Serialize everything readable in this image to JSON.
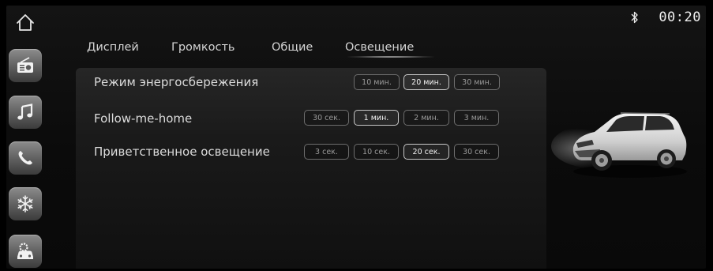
{
  "status": {
    "bluetooth_icon": "bluetooth-icon",
    "time": "00:20"
  },
  "sidebar": {
    "home_icon": "home-icon",
    "items": [
      {
        "name": "radio",
        "icon": "radio-icon"
      },
      {
        "name": "music",
        "icon": "music-note-icon"
      },
      {
        "name": "phone",
        "icon": "phone-icon"
      },
      {
        "name": "climate",
        "icon": "snowflake-icon"
      },
      {
        "name": "car-settings",
        "icon": "car-settings-icon"
      }
    ]
  },
  "tabs": [
    {
      "label": "Дисплей",
      "active": false
    },
    {
      "label": "Громкость",
      "active": false
    },
    {
      "label": "Общие",
      "active": false
    },
    {
      "label": "Освещение",
      "active": true
    }
  ],
  "settings": {
    "energy_saving": {
      "label": "Режим энергосбережения",
      "options": [
        "10 мин.",
        "20 мин.",
        "30 мин."
      ],
      "selected": "20 мин."
    },
    "follow_me_home": {
      "label": "Follow-me-home",
      "options": [
        "30 сек.",
        "1 мин.",
        "2 мин.",
        "3 мин."
      ],
      "selected": "1 мин."
    },
    "welcome_lighting": {
      "label": "Приветственное освещение",
      "options": [
        "3 сек.",
        "10 сек.",
        "20 сек.",
        "30 сек."
      ],
      "selected": "20 сек."
    }
  },
  "colors": {
    "accent": "#ffffff",
    "background": "#0b0b0b",
    "panel": "#1e1e1e",
    "tile": "#6e6e6e"
  }
}
